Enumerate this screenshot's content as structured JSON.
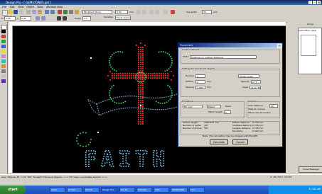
{
  "window": {
    "title": "Design Pro - [ GEMSTONES.jpd ]"
  },
  "menu": [
    "File",
    "Edit",
    "View",
    "Object",
    "Tools",
    "Window",
    "Help"
  ],
  "toolbar": {
    "font_combo": "Tall Wood Stone",
    "size_combo": "2.50",
    "unit_label": "mm",
    "line_width_label": "line width",
    "line_width_value": "30",
    "line_width_unit": "mm",
    "xy_label1": "X:",
    "xy_value1": "0.00",
    "y_label1": "Y:",
    "y_value1": "0.00",
    "angle_label": "Angle",
    "angle_value": "0.0",
    "variation_label": "Variation",
    "variation_value": "Equal spaced"
  },
  "right_panel": {
    "header": "Group",
    "list_item": "Calculation (line)",
    "message_button": "Close Message"
  },
  "dialog": {
    "title": "Placement",
    "close": "x",
    "section_control": "Control element",
    "mode_label": "Mode",
    "mode_value": "Positions on outline (distance)",
    "section_settings": "Settings for placement objects",
    "number_label": "Number",
    "number_value": "7",
    "type_value": "Small circles",
    "outline_label": "Outline",
    "outline_value": "0",
    "outline_unit": "mm",
    "spacing_label": "Spacing",
    "spacing_value": "1.000",
    "spacing_unit": "mm",
    "opacity_label": "Opacity",
    "opacity_value": "27.0",
    "layer_label": "Layer",
    "layer_value": "Layer 30",
    "section_procedure": "Procedure",
    "procedure_value": "Fill cont",
    "direction_value": "Mixed",
    "fixed_label": "Fixed",
    "match_length_label": "Match length",
    "match_length_value": "3",
    "corners_label": "Corners",
    "corner_opt1": "Auto distance",
    "corner_opt2": "Mark at corners",
    "corner_opt3": "Place only at corners",
    "corner_value": "60",
    "stats": [
      {
        "k": "Outline length:",
        "v": "1060.637 mm"
      },
      {
        "k": "Number of paths:",
        "v": "187"
      },
      {
        "k": "Number of stones:",
        "v": "587"
      }
    ],
    "stats2": [
      {
        "k": "Middle distance:",
        "v": "2.778 mm"
      },
      {
        "k": "Smallest distance:",
        "v": "2.778 mm"
      },
      {
        "k": "Largest distance:",
        "v": "2.778 mm"
      },
      {
        "k": "Deviation:",
        "v": "0.000 mm"
      }
    ],
    "note": "Note: The calculation may be stopped with ESCAPE.",
    "calculate_label": "Calculate",
    "cancel_label": "Cancel"
  },
  "status": {
    "left": "Line: Objects: 40 - Line: Text: Straight outlines & Objects: >>> Fill: Open coordinates sample: >>>",
    "right": "X: -65.754 Y: 14.707"
  },
  "taskbar": {
    "start": "start",
    "tasks": [
      "Inbox",
      "JP Fest",
      "Pocket",
      "Design Pro",
      "Pro DJ",
      "Schneid",
      "CAD",
      "GEMSTONE",
      "CUT"
    ],
    "clock": "11:48 AM"
  },
  "canvas_text": "FAITH",
  "colors": {
    "canvas": "#000000",
    "title": "#0a246a",
    "red": "#d83030",
    "green": "#3cc06a",
    "blue": "#4a9fe0",
    "white": "#ffffff"
  }
}
